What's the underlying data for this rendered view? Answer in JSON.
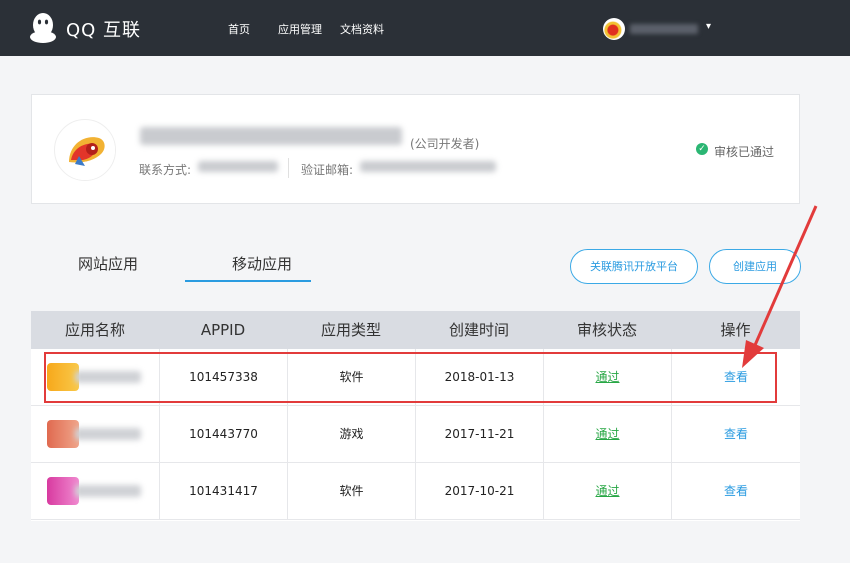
{
  "header": {
    "brand": "QQ 互联",
    "nav": [
      "首页",
      "应用管理",
      "文档资料"
    ],
    "caret": "▾"
  },
  "profile": {
    "developer_type": "(公司开发者)",
    "contact_label": "联系方式:",
    "email_label": "验证邮箱:",
    "status_text": "审核已通过",
    "status_check": "✓"
  },
  "tabs": [
    {
      "label": "网站应用",
      "active": false
    },
    {
      "label": "移动应用",
      "active": true
    }
  ],
  "buttons": {
    "link_platform": "关联腾讯开放平台",
    "create_app": "创建应用"
  },
  "table": {
    "columns": [
      "应用名称",
      "APPID",
      "应用类型",
      "创建时间",
      "审核状态",
      "操作"
    ],
    "rows": [
      {
        "appid": "101457338",
        "type": "软件",
        "created": "2018-01-13",
        "status": "通过",
        "action": "查看"
      },
      {
        "appid": "101443770",
        "type": "游戏",
        "created": "2017-11-21",
        "status": "通过",
        "action": "查看"
      },
      {
        "appid": "101431417",
        "type": "软件",
        "created": "2017-10-21",
        "status": "通过",
        "action": "查看"
      }
    ]
  },
  "colors": {
    "topbar": "#2b3037",
    "accent": "#2a9be0",
    "success": "#28a745",
    "annotation": "#e23b3b"
  }
}
